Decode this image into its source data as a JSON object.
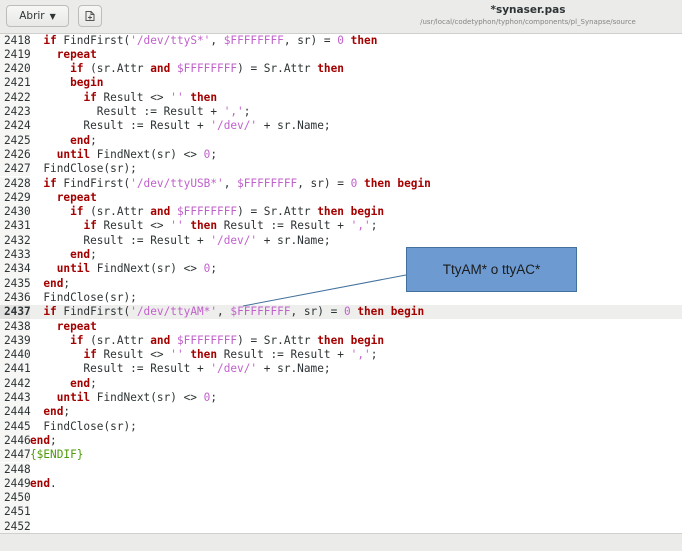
{
  "header": {
    "open_label": "Abrir",
    "title": "*synaser.pas",
    "path": "/usr/local/codetyphon/typhon/components/pl_Synapse/source"
  },
  "annotation": {
    "text": "TtyAM* o ttyAC*"
  },
  "lines": [
    {
      "n": "2418",
      "tokens": [
        [
          "t",
          "  "
        ],
        [
          "k",
          "if"
        ],
        [
          "t",
          " FindFirst("
        ],
        [
          "s",
          "'/dev/ttyS*'"
        ],
        [
          "t",
          ", "
        ],
        [
          "s",
          "$FFFFFFFF"
        ],
        [
          "t",
          ", sr) = "
        ],
        [
          "s",
          "0"
        ],
        [
          "t",
          " "
        ],
        [
          "k",
          "then"
        ]
      ]
    },
    {
      "n": "2419",
      "tokens": [
        [
          "t",
          "    "
        ],
        [
          "k",
          "repeat"
        ]
      ]
    },
    {
      "n": "2420",
      "tokens": [
        [
          "t",
          "      "
        ],
        [
          "k",
          "if"
        ],
        [
          "t",
          " (sr.Attr "
        ],
        [
          "k",
          "and"
        ],
        [
          "t",
          " "
        ],
        [
          "s",
          "$FFFFFFFF"
        ],
        [
          "t",
          ") = Sr.Attr "
        ],
        [
          "k",
          "then"
        ]
      ]
    },
    {
      "n": "2421",
      "tokens": [
        [
          "t",
          "      "
        ],
        [
          "k",
          "begin"
        ]
      ]
    },
    {
      "n": "2422",
      "tokens": [
        [
          "t",
          "        "
        ],
        [
          "k",
          "if"
        ],
        [
          "t",
          " Result <> "
        ],
        [
          "s",
          "''"
        ],
        [
          "t",
          " "
        ],
        [
          "k",
          "then"
        ]
      ]
    },
    {
      "n": "2423",
      "tokens": [
        [
          "t",
          "          Result := Result + "
        ],
        [
          "s",
          "','"
        ],
        [
          "t",
          ";"
        ]
      ]
    },
    {
      "n": "2424",
      "tokens": [
        [
          "t",
          "        Result := Result + "
        ],
        [
          "s",
          "'/dev/'"
        ],
        [
          "t",
          " + sr.Name;"
        ]
      ]
    },
    {
      "n": "2425",
      "tokens": [
        [
          "t",
          "      "
        ],
        [
          "k",
          "end"
        ],
        [
          "t",
          ";"
        ]
      ]
    },
    {
      "n": "2426",
      "tokens": [
        [
          "t",
          "    "
        ],
        [
          "k",
          "until"
        ],
        [
          "t",
          " FindNext(sr) <> "
        ],
        [
          "s",
          "0"
        ],
        [
          "t",
          ";"
        ]
      ]
    },
    {
      "n": "2427",
      "tokens": [
        [
          "t",
          "  FindClose(sr);"
        ]
      ]
    },
    {
      "n": "2428",
      "tokens": [
        [
          "t",
          "  "
        ],
        [
          "k",
          "if"
        ],
        [
          "t",
          " FindFirst("
        ],
        [
          "s",
          "'/dev/ttyUSB*'"
        ],
        [
          "t",
          ", "
        ],
        [
          "s",
          "$FFFFFFFF"
        ],
        [
          "t",
          ", sr) = "
        ],
        [
          "s",
          "0"
        ],
        [
          "t",
          " "
        ],
        [
          "k",
          "then begin"
        ]
      ]
    },
    {
      "n": "2429",
      "tokens": [
        [
          "t",
          "    "
        ],
        [
          "k",
          "repeat"
        ]
      ]
    },
    {
      "n": "2430",
      "tokens": [
        [
          "t",
          "      "
        ],
        [
          "k",
          "if"
        ],
        [
          "t",
          " (sr.Attr "
        ],
        [
          "k",
          "and"
        ],
        [
          "t",
          " "
        ],
        [
          "s",
          "$FFFFFFFF"
        ],
        [
          "t",
          ") = Sr.Attr "
        ],
        [
          "k",
          "then begin"
        ]
      ]
    },
    {
      "n": "2431",
      "tokens": [
        [
          "t",
          "        "
        ],
        [
          "k",
          "if"
        ],
        [
          "t",
          " Result <> "
        ],
        [
          "s",
          "''"
        ],
        [
          "t",
          " "
        ],
        [
          "k",
          "then"
        ],
        [
          "t",
          " Result := Result + "
        ],
        [
          "s",
          "','"
        ],
        [
          "t",
          ";"
        ]
      ]
    },
    {
      "n": "2432",
      "tokens": [
        [
          "t",
          "        Result := Result + "
        ],
        [
          "s",
          "'/dev/'"
        ],
        [
          "t",
          " + sr.Name;"
        ]
      ]
    },
    {
      "n": "2433",
      "tokens": [
        [
          "t",
          "      "
        ],
        [
          "k",
          "end"
        ],
        [
          "t",
          ";"
        ]
      ]
    },
    {
      "n": "2434",
      "tokens": [
        [
          "t",
          "    "
        ],
        [
          "k",
          "until"
        ],
        [
          "t",
          " FindNext(sr) <> "
        ],
        [
          "s",
          "0"
        ],
        [
          "t",
          ";"
        ]
      ]
    },
    {
      "n": "2435",
      "tokens": [
        [
          "t",
          "  "
        ],
        [
          "k",
          "end"
        ],
        [
          "t",
          ";"
        ]
      ]
    },
    {
      "n": "2436",
      "tokens": [
        [
          "t",
          "  FindClose(sr);"
        ]
      ]
    },
    {
      "n": "2437",
      "current": true,
      "tokens": [
        [
          "t",
          "  "
        ],
        [
          "k",
          "if"
        ],
        [
          "t",
          " FindFirst("
        ],
        [
          "s",
          "'/dev/ttyAM*'"
        ],
        [
          "t",
          ", "
        ],
        [
          "s",
          "$FFFFFFFF"
        ],
        [
          "t",
          ", sr) = "
        ],
        [
          "s",
          "0"
        ],
        [
          "t",
          " "
        ],
        [
          "k",
          "then begin"
        ]
      ]
    },
    {
      "n": "2438",
      "tokens": [
        [
          "t",
          "    "
        ],
        [
          "k",
          "repeat"
        ]
      ]
    },
    {
      "n": "2439",
      "tokens": [
        [
          "t",
          "      "
        ],
        [
          "k",
          "if"
        ],
        [
          "t",
          " (sr.Attr "
        ],
        [
          "k",
          "and"
        ],
        [
          "t",
          " "
        ],
        [
          "s",
          "$FFFFFFFF"
        ],
        [
          "t",
          ") = Sr.Attr "
        ],
        [
          "k",
          "then begin"
        ]
      ]
    },
    {
      "n": "2440",
      "tokens": [
        [
          "t",
          "        "
        ],
        [
          "k",
          "if"
        ],
        [
          "t",
          " Result <> "
        ],
        [
          "s",
          "''"
        ],
        [
          "t",
          " "
        ],
        [
          "k",
          "then"
        ],
        [
          "t",
          " Result := Result + "
        ],
        [
          "s",
          "','"
        ],
        [
          "t",
          ";"
        ]
      ]
    },
    {
      "n": "2441",
      "tokens": [
        [
          "t",
          "        Result := Result + "
        ],
        [
          "s",
          "'/dev/'"
        ],
        [
          "t",
          " + sr.Name;"
        ]
      ]
    },
    {
      "n": "2442",
      "tokens": [
        [
          "t",
          "      "
        ],
        [
          "k",
          "end"
        ],
        [
          "t",
          ";"
        ]
      ]
    },
    {
      "n": "2443",
      "tokens": [
        [
          "t",
          "    "
        ],
        [
          "k",
          "until"
        ],
        [
          "t",
          " FindNext(sr) <> "
        ],
        [
          "s",
          "0"
        ],
        [
          "t",
          ";"
        ]
      ]
    },
    {
      "n": "2444",
      "tokens": [
        [
          "t",
          "  "
        ],
        [
          "k",
          "end"
        ],
        [
          "t",
          ";"
        ]
      ]
    },
    {
      "n": "2445",
      "tokens": [
        [
          "t",
          "  FindClose(sr);"
        ]
      ]
    },
    {
      "n": "2446",
      "tokens": [
        [
          "k",
          "end"
        ],
        [
          "t",
          ";"
        ]
      ]
    },
    {
      "n": "2447",
      "tokens": [
        [
          "d",
          "{$ENDIF}"
        ]
      ]
    },
    {
      "n": "2448",
      "tokens": []
    },
    {
      "n": "2449",
      "tokens": [
        [
          "k",
          "end"
        ],
        [
          "t",
          "."
        ]
      ]
    },
    {
      "n": "2450",
      "tokens": []
    },
    {
      "n": "2451",
      "tokens": []
    },
    {
      "n": "2452",
      "tokens": []
    }
  ]
}
